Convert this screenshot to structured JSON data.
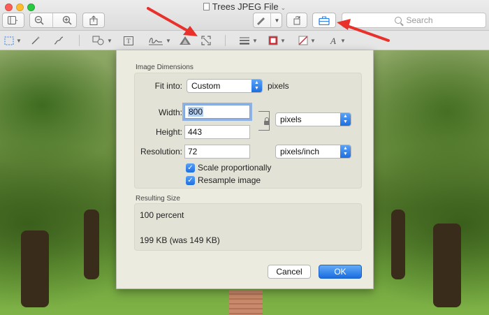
{
  "window": {
    "title": "Trees JPEG File",
    "title_chevron": "⌄"
  },
  "toolbar": {
    "search_placeholder": "Search"
  },
  "dialog": {
    "image_dimensions_label": "Image Dimensions",
    "fit_into_label": "Fit into:",
    "fit_into_value": "Custom",
    "fit_into_unit": "pixels",
    "width_label": "Width:",
    "width_value": "800",
    "height_label": "Height:",
    "height_value": "443",
    "size_unit_value": "pixels",
    "resolution_label": "Resolution:",
    "resolution_value": "72",
    "resolution_unit_value": "pixels/inch",
    "scale_proportionally_label": "Scale proportionally",
    "scale_proportionally_checked": true,
    "resample_label": "Resample image",
    "resample_checked": true,
    "resulting_size_label": "Resulting Size",
    "result_percent": "100 percent",
    "result_filesize": "199 KB (was 149 KB)",
    "cancel_label": "Cancel",
    "ok_label": "OK"
  },
  "colors": {
    "annotation_arrow": "#e8312b",
    "accent_blue": "#1d6fe0"
  }
}
